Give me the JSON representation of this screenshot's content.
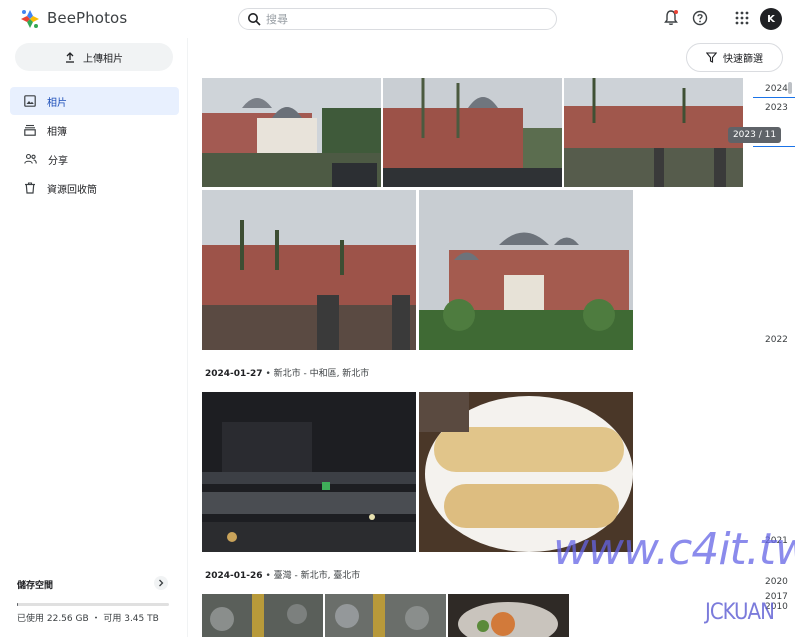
{
  "app": {
    "brand": "BeePhotos"
  },
  "search": {
    "placeholder": "搜尋"
  },
  "header": {
    "avatar_initial": "K",
    "notification_dot_color": "#ea4335"
  },
  "sidebar": {
    "upload_label": "上傳相片",
    "items": [
      {
        "label": "相片",
        "icon": "photo-icon",
        "active": true
      },
      {
        "label": "相簿",
        "icon": "album-icon",
        "active": false
      },
      {
        "label": "分享",
        "icon": "share-icon",
        "active": false
      },
      {
        "label": "資源回收筒",
        "icon": "trash-icon",
        "active": false
      }
    ],
    "storage": {
      "title": "儲存空間",
      "usage_text": "已使用 22.56 GB ・ 可用 3.45 TB",
      "used_fraction": 0.006
    }
  },
  "main": {
    "filter_label": "快速篩選",
    "groups": [
      {
        "date": "2024-01-27",
        "place": "新北市 - 中和區, 新北市"
      },
      {
        "date": "2024-01-26",
        "place": "臺灣 - 新北市, 臺北市"
      }
    ]
  },
  "timeline": {
    "years": [
      "2024",
      "2023",
      "2022",
      "2021",
      "2020",
      "2017",
      "2010"
    ],
    "tooltip": "2023 / 11"
  },
  "watermark": {
    "site": "www.c4it.tw",
    "author": "JCKUAN"
  },
  "colors": {
    "accent": "#1a73e8",
    "active_bg": "#e8f0fe"
  }
}
